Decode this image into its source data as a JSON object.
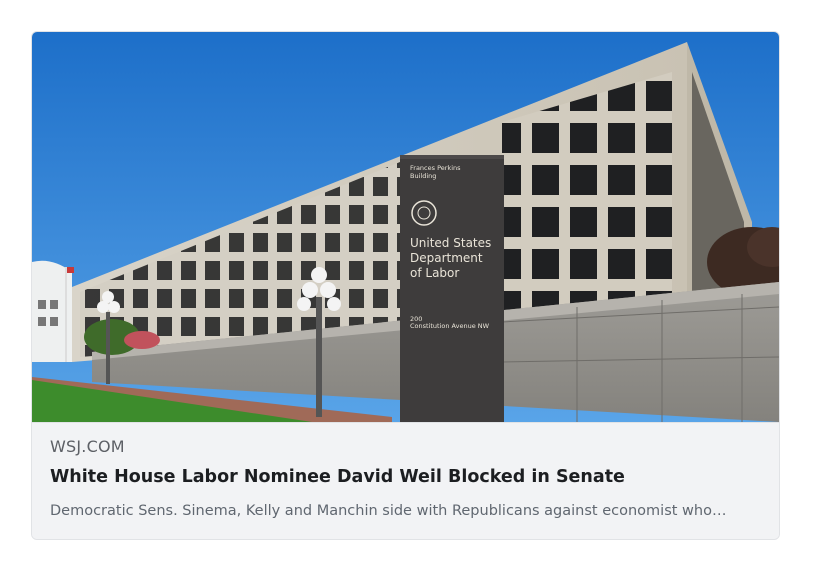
{
  "link_preview": {
    "domain": "WSJ.COM",
    "title": "White House Labor Nominee David Weil Blocked in Senate",
    "description": "Democratic Sens. Sinema, Kelly and Manchin side with Republicans against economist who…",
    "image": {
      "sign_building_name": "Frances Perkins Building",
      "sign_agency": [
        "United States",
        "Department",
        "of Labor"
      ],
      "sign_address": "200 Constitution Avenue NW",
      "icon": "department-of-labor-seal-icon"
    }
  }
}
